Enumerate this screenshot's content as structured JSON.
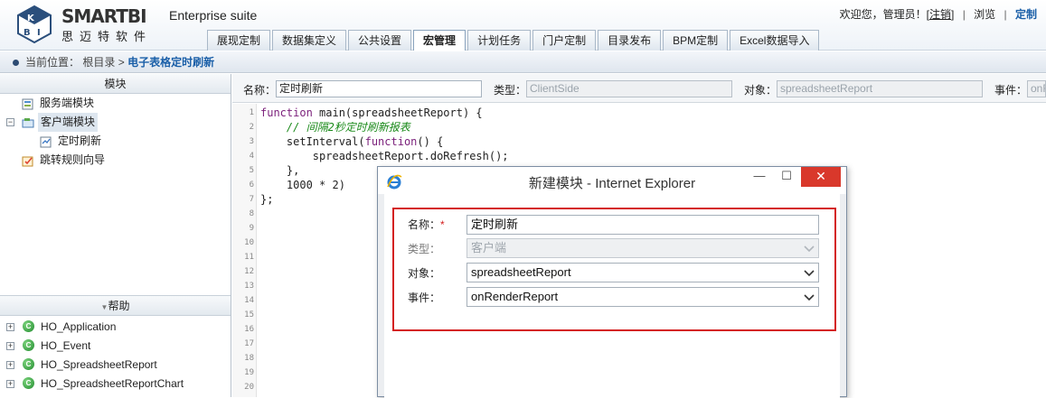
{
  "brand": {
    "name": "SMARTBI",
    "subtitle_cn": "思迈特软件",
    "suite": "Enterprise suite"
  },
  "topbar": {
    "welcome": "欢迎您，管理员！[",
    "logout": "注销",
    "close_bracket": "]",
    "sep": "|",
    "browse": "浏览",
    "customize": "定制"
  },
  "tabs": [
    "展现定制",
    "数据集定义",
    "公共设置",
    "宏管理",
    "计划任务",
    "门户定制",
    "目录发布",
    "BPM定制",
    "Excel数据导入"
  ],
  "breadcrumb": {
    "prefix": "当前位置：",
    "root": "根目录",
    "sep": ">",
    "current": "电子表格定时刷新"
  },
  "module_panel": {
    "title": "模块",
    "items": [
      {
        "label": "服务端模块"
      },
      {
        "label": "客户端模块"
      },
      {
        "label": "定时刷新"
      },
      {
        "label": "跳转规则向导"
      }
    ]
  },
  "help_panel": {
    "title": "帮助",
    "items": [
      "HO_Application",
      "HO_Event",
      "HO_SpreadsheetReport",
      "HO_SpreadsheetReportChart"
    ]
  },
  "attributes": {
    "name_label": "名称：",
    "name_value": "定时刷新",
    "type_label": "类型：",
    "type_value": "ClientSide",
    "object_label": "对象：",
    "object_value": "spreadsheetReport",
    "event_label": "事件：",
    "event_value": "onR"
  },
  "editor": {
    "line_numbers": [
      "1",
      "2",
      "3",
      "4",
      "5",
      "6",
      "7",
      "8",
      "9",
      "10",
      "11",
      "12",
      "13",
      "14",
      "15",
      "16",
      "17",
      "18",
      "19",
      "20"
    ],
    "code": {
      "l1_kw": "function",
      "l1_rest": " main(spreadsheetReport) {",
      "l2": "    // 间隔2秒定时刷新报表",
      "l3_a": "    setInterval(",
      "l3_kw": "function",
      "l3_b": "() {",
      "l4": "        spreadsheetReport.doRefresh();",
      "l5": "    },",
      "l6": "    1000 * 2)",
      "l7": "};"
    }
  },
  "dialog": {
    "title": "新建模块 - Internet Explorer",
    "min": "—",
    "max": "☐",
    "close": "✕",
    "name_label": "名称：",
    "required_mark": "*",
    "name_value": "定时刷新",
    "type_label": "类型：",
    "type_value": "客户端",
    "object_label": "对象：",
    "object_value": "spreadsheetReport",
    "event_label": "事件：",
    "event_value": "onRenderReport"
  },
  "colors": {
    "accent": "#1a5fa8",
    "highlight_border": "#d41f1f",
    "close_button": "#d9382b"
  }
}
